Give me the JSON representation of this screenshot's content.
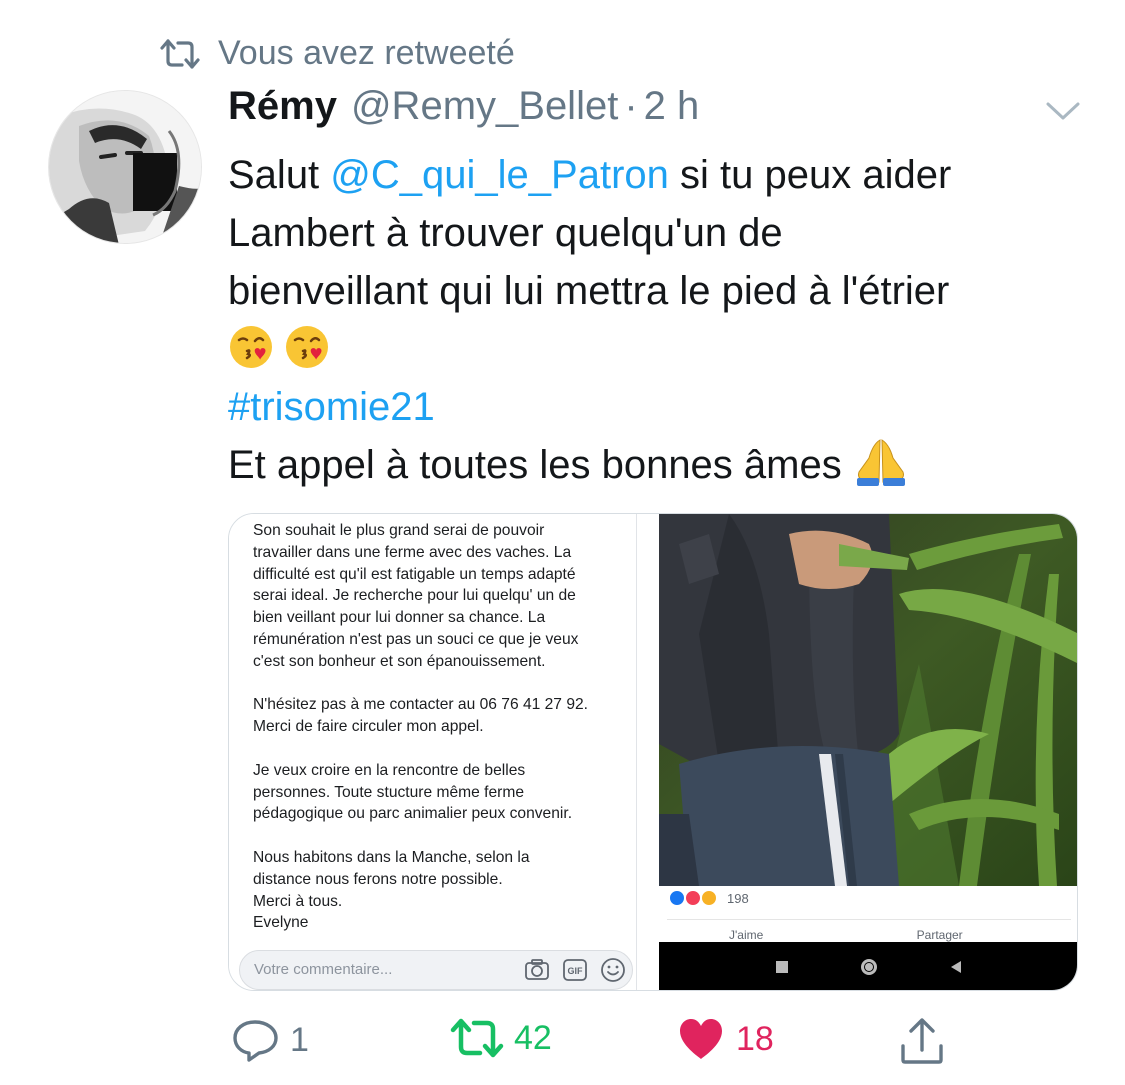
{
  "retweet_context": {
    "label": "Vous avez retweeté"
  },
  "tweet": {
    "author_name": "Rémy",
    "author_handle": "@Remy_Bellet",
    "separator": "·",
    "time": "2 h",
    "lines": {
      "l1_prefix": "Salut ",
      "mention": "@C_qui_le_Patron",
      "l1_suffix": " si tu peux aider",
      "l2": "Lambert à trouver quelqu'un de",
      "l3": "bienveillant qui lui mettra le pied à l'étrier",
      "hashtag": "#trisomie21",
      "l5": "Et appel à toutes les bonnes âmes"
    }
  },
  "media": {
    "facebook_post": {
      "paragraphs": [
        [
          "Son souhait le plus grand serai de pouvoir",
          "travailler dans une ferme avec des vaches.  La",
          "difficulté est qu'il est fatigable un temps adapté",
          "serai ideal. Je recherche pour lui quelqu' un de",
          "bien veillant pour lui donner sa chance. La",
          "rémunération n'est pas un souci ce que je veux",
          "c'est son bonheur et son épanouissement."
        ],
        [
          "N'hésitez pas à me contacter au 06 76 41 27 92.",
          "Merci de faire circuler  mon appel."
        ],
        [
          "Je veux croire en la rencontre de belles",
          "personnes. Toute stucture même ferme",
          "pédagogique ou parc animalier peux convenir."
        ],
        [
          "Nous habitons dans la Manche, selon la",
          "distance nous ferons notre possible.",
          "Merci à tous.",
          "Evelyne"
        ]
      ],
      "comment_placeholder": "Votre commentaire...",
      "gif_label": "GIF"
    },
    "photo_post": {
      "reaction_count": "198",
      "action_like": "J'aime",
      "action_share": "Partager"
    }
  },
  "stats": {
    "replies": "1",
    "retweets": "42",
    "likes": "18"
  },
  "colors": {
    "link": "#1da1f2",
    "retweet_active": "#17bf63",
    "like_active": "#e0245e",
    "muted": "#657786"
  }
}
